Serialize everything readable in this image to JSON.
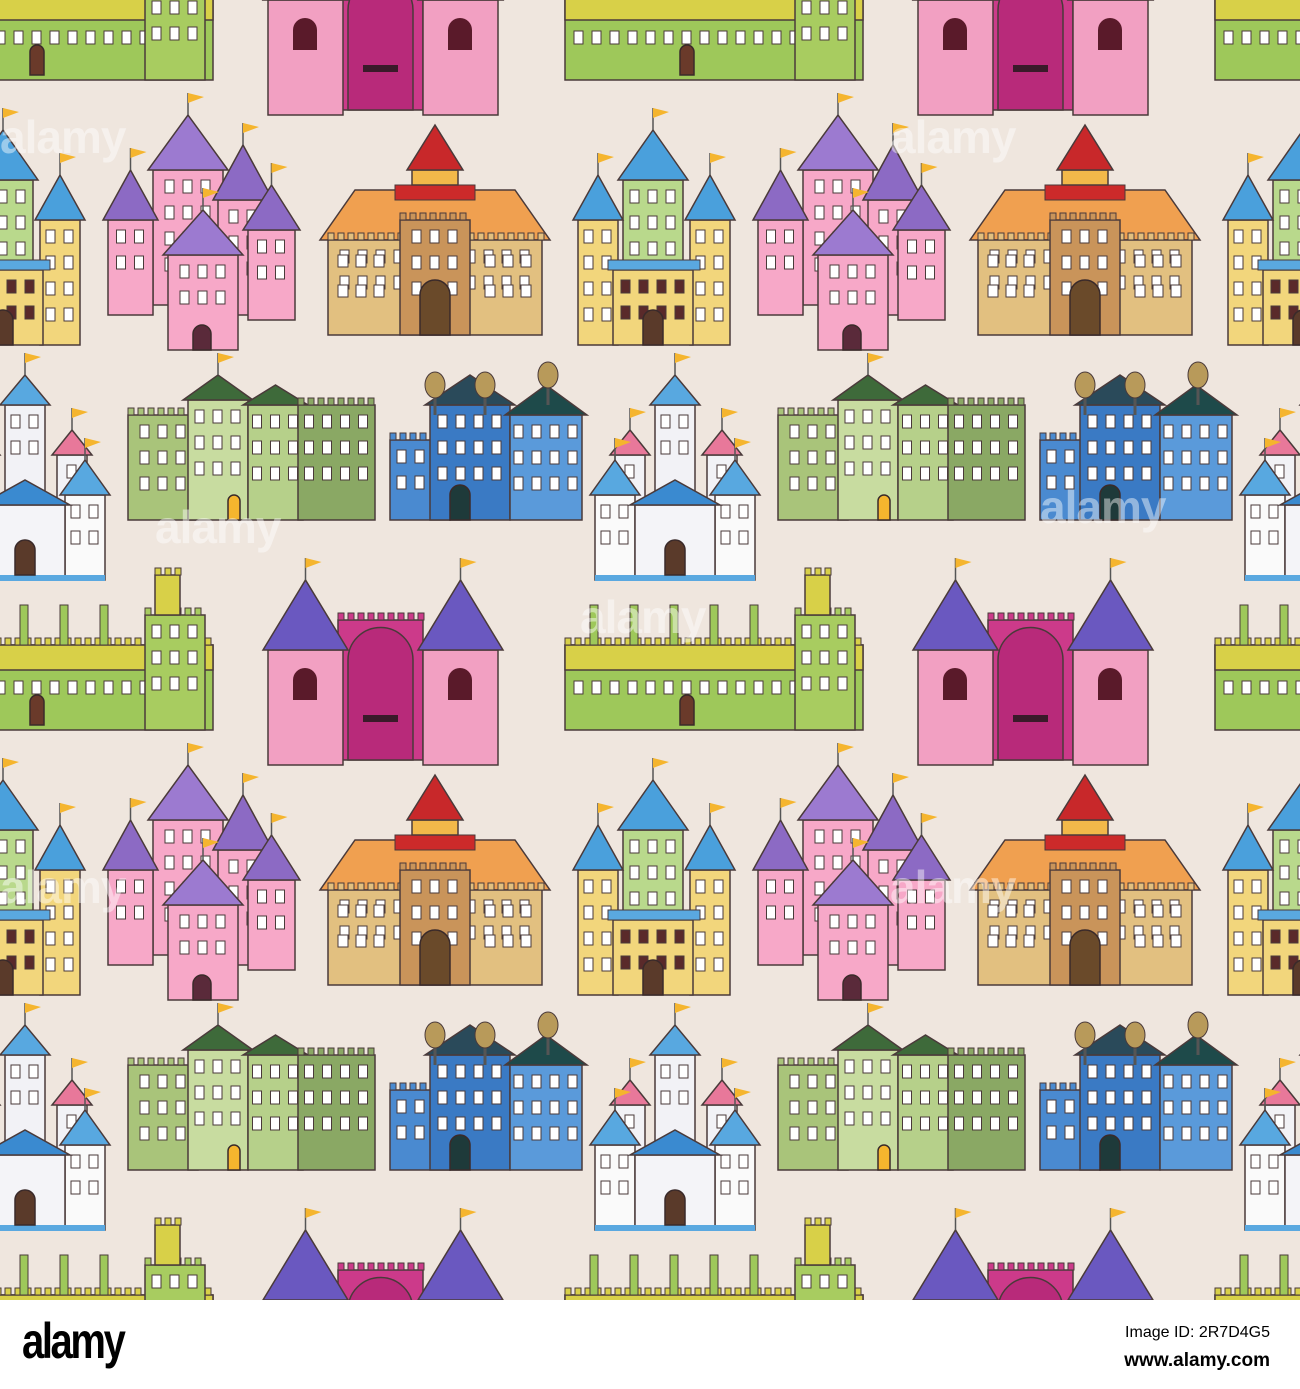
{
  "pattern": {
    "background": "#efe6de",
    "watermark": "alamy",
    "castles": [
      "blue-yellow-castle",
      "pink-purple-castle",
      "orange-hall",
      "white-castle",
      "green-castle",
      "blue-church",
      "yellow-green-castle",
      "pink-twin-castle"
    ]
  },
  "footer": {
    "logo": "alamy",
    "image_id": "Image ID: 2R7D4G5",
    "url": "www.alamy.com"
  }
}
